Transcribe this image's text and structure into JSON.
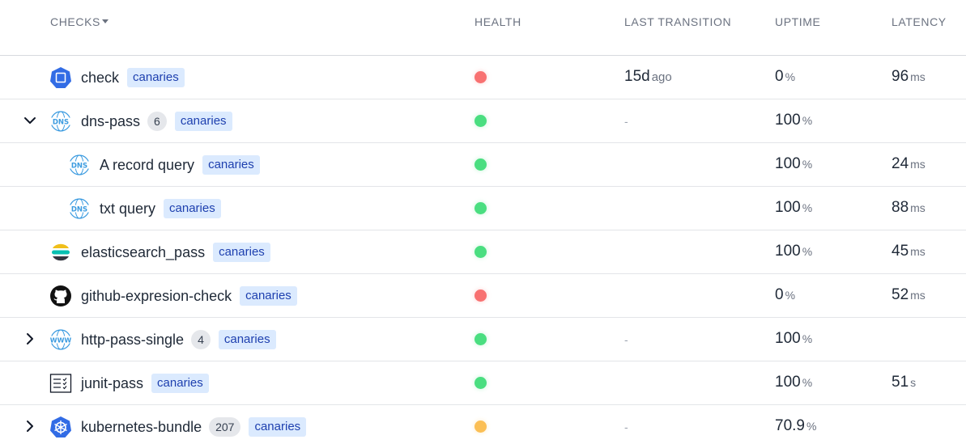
{
  "columns": {
    "checks": "CHECKS",
    "health": "HEALTH",
    "last_transition": "LAST TRANSITION",
    "uptime": "UPTIME",
    "latency": "LATENCY"
  },
  "colors": {
    "healthy": "#4ade80",
    "unhealthy": "#f87171",
    "warning": "#fbbf55"
  },
  "rows": [
    {
      "name": "check",
      "icon": "kubernetes-icon",
      "count": "",
      "badge": "canaries",
      "health": "unhealthy",
      "transition_value": "15d",
      "transition_unit": "ago",
      "uptime": "0",
      "uptime_unit": "%",
      "latency": "96",
      "latency_unit": "ms",
      "expander": "",
      "indent": 0
    },
    {
      "name": "dns-pass",
      "icon": "dns-icon",
      "count": "6",
      "badge": "canaries",
      "health": "healthy",
      "transition_value": "-",
      "transition_unit": "",
      "uptime": "100",
      "uptime_unit": "%",
      "latency": "",
      "latency_unit": "",
      "expander": "expanded",
      "indent": 0
    },
    {
      "name": "A record query",
      "icon": "dns-icon",
      "count": "",
      "badge": "canaries",
      "health": "healthy",
      "transition_value": "",
      "transition_unit": "",
      "uptime": "100",
      "uptime_unit": "%",
      "latency": "24",
      "latency_unit": "ms",
      "expander": "",
      "indent": 1
    },
    {
      "name": "txt query",
      "icon": "dns-icon",
      "count": "",
      "badge": "canaries",
      "health": "healthy",
      "transition_value": "",
      "transition_unit": "",
      "uptime": "100",
      "uptime_unit": "%",
      "latency": "88",
      "latency_unit": "ms",
      "expander": "",
      "indent": 1
    },
    {
      "name": "elasticsearch_pass",
      "icon": "elasticsearch-icon",
      "count": "",
      "badge": "canaries",
      "health": "healthy",
      "transition_value": "",
      "transition_unit": "",
      "uptime": "100",
      "uptime_unit": "%",
      "latency": "45",
      "latency_unit": "ms",
      "expander": "",
      "indent": 0
    },
    {
      "name": "github-expresion-check",
      "icon": "github-icon",
      "count": "",
      "badge": "canaries",
      "health": "unhealthy",
      "transition_value": "",
      "transition_unit": "",
      "uptime": "0",
      "uptime_unit": "%",
      "latency": "52",
      "latency_unit": "ms",
      "expander": "",
      "indent": 0
    },
    {
      "name": "http-pass-single",
      "icon": "http-icon",
      "count": "4",
      "badge": "canaries",
      "health": "healthy",
      "transition_value": "-",
      "transition_unit": "",
      "uptime": "100",
      "uptime_unit": "%",
      "latency": "",
      "latency_unit": "",
      "expander": "collapsed",
      "indent": 0
    },
    {
      "name": "junit-pass",
      "icon": "junit-icon",
      "count": "",
      "badge": "canaries",
      "health": "healthy",
      "transition_value": "",
      "transition_unit": "",
      "uptime": "100",
      "uptime_unit": "%",
      "latency": "51",
      "latency_unit": "s",
      "expander": "",
      "indent": 0
    },
    {
      "name": "kubernetes-bundle",
      "icon": "kubernetes-wheel-icon",
      "count": "207",
      "badge": "canaries",
      "health": "warning",
      "transition_value": "-",
      "transition_unit": "",
      "uptime": "70.9",
      "uptime_unit": "%",
      "latency": "",
      "latency_unit": "",
      "expander": "collapsed",
      "indent": 0
    }
  ]
}
